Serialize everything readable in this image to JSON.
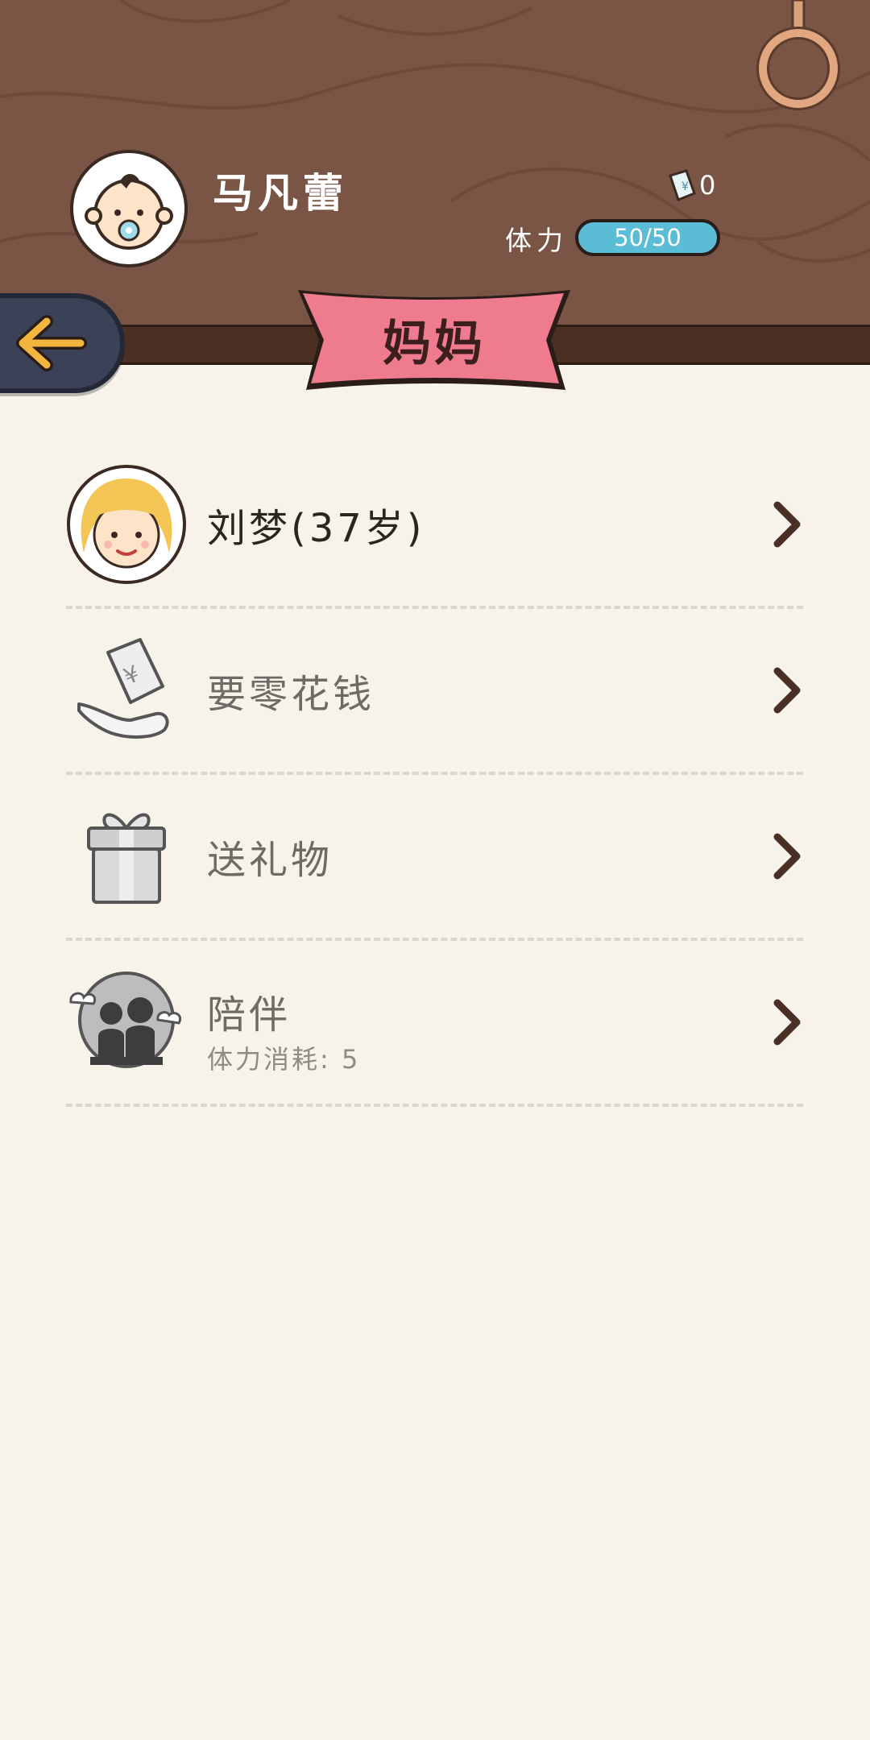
{
  "header": {
    "player_name": "马凡蕾",
    "money": "0",
    "stamina_label": "体力",
    "stamina_value": "50/50",
    "icons": [
      "baby-avatar",
      "money-note-icon",
      "ring-icon"
    ]
  },
  "banner": {
    "title": "妈妈"
  },
  "back_button": {
    "icon": "arrow-left-icon"
  },
  "items": [
    {
      "label": "刘梦(37岁)",
      "icon": "mother-avatar"
    },
    {
      "label": "要零花钱",
      "icon": "money-hand-icon"
    },
    {
      "label": "送礼物",
      "icon": "gift-icon"
    },
    {
      "label": "陪伴",
      "sub": "体力消耗: 5",
      "icon": "companion-icon"
    }
  ],
  "colors": {
    "wood": "#7a5444",
    "banner": "#ef7b8f",
    "stamina": "#5bbcd6",
    "background": "#f7f3ea"
  }
}
